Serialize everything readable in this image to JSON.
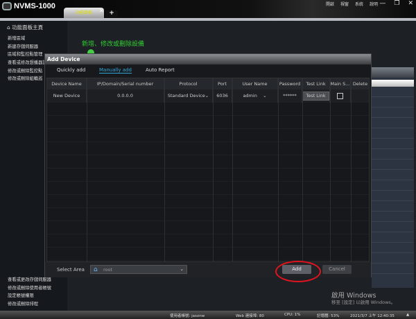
{
  "app": {
    "title": "NVMS-1000",
    "menu": [
      "開啟",
      "視窗",
      "系統",
      "說明"
    ],
    "window_controls": [
      "—",
      "❐",
      "✕"
    ],
    "tab": "功能面板",
    "tab_add": "+"
  },
  "sidebar": {
    "home": "功能面板主頁",
    "items": [
      "新增區域",
      "新建存儲伺服器",
      "區域和監控點管理",
      "查看或修改想播器設",
      "修改或刪除監控點",
      "修改或刪除組輪巡",
      "查看或更改存儲伺服器",
      "修改或刪除使用者帳號",
      "設定帳號權限",
      "修改或刪除排程"
    ]
  },
  "main": {
    "heading": "新增、修改或刪除設備"
  },
  "dialog": {
    "title": "Add Device",
    "tabs": [
      "Quickly add",
      "Manually add",
      "Auto Report"
    ],
    "active_tab": "Manually add",
    "columns": [
      "Device Name",
      "IP/Domain/Serial number",
      "Protocol",
      "Port",
      "User Name",
      "Password",
      "Test Link",
      "Main S...",
      "Delete"
    ],
    "rows": [
      {
        "device_name": "New Device",
        "ip": "0.0.0.0",
        "protocol": "Standard Device",
        "port": "6036",
        "user": "admin",
        "password": "******",
        "test_link": "Test Link",
        "main_stream": false
      }
    ],
    "select_area_label": "Select Area",
    "area": "root",
    "add": "Add",
    "cancel": "Cancel"
  },
  "watermark": {
    "line1": "啟用 Windows",
    "line2": "移至 [設定] 以啟用 Windows。"
  },
  "status": {
    "user": "使用者帳號: jasonw",
    "web": "Web 連接埠: 80",
    "cpu": "CPU: 1%",
    "memory": "記憶體: 53%",
    "datetime": "2021/3/7 上午 12:40:35"
  },
  "colors": {
    "accent": "#33aadd",
    "heading": "#33cc33",
    "highlight": "#e0141e"
  }
}
